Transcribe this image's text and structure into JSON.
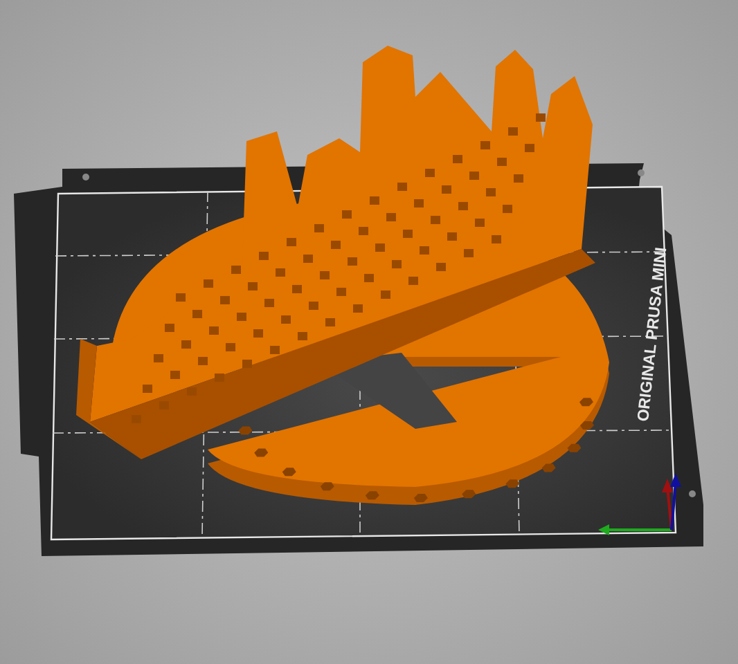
{
  "bed": {
    "label": "ORIGINAL PRUSA MINI"
  }
}
